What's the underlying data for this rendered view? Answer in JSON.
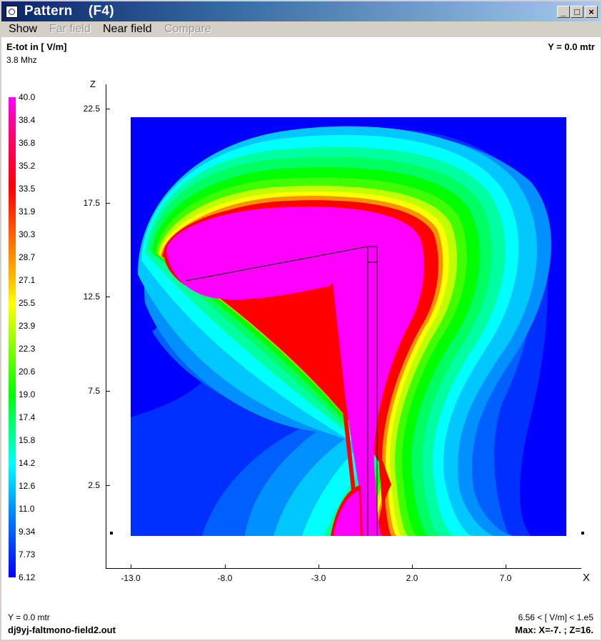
{
  "window": {
    "title": "Pattern    (F4)",
    "buttons": {
      "minimize": "_",
      "maximize": "□",
      "close": "×"
    }
  },
  "menu": [
    {
      "label": "Show",
      "enabled": true
    },
    {
      "label": "Far field",
      "enabled": false
    },
    {
      "label": "Near field",
      "enabled": true
    },
    {
      "label": "Compare",
      "enabled": false
    }
  ],
  "header": {
    "quantity": "E-tot in [ V/m]",
    "frequency": "3.8 Mhz",
    "plane": "Y = 0.0 mtr"
  },
  "footer": {
    "plane": "Y = 0.0 mtr",
    "filename": "dj9yj-faltmono-field2.out",
    "range": "6.56 < [ V/m] < 1.e5",
    "max": "Max: X=-7. ; Z=16."
  },
  "legend": {
    "values": [
      "40.0",
      "38.4",
      "36.8",
      "35.2",
      "33.5",
      "31.9",
      "30.3",
      "28.7",
      "27.1",
      "25.5",
      "23.9",
      "22.3",
      "20.6",
      "19.0",
      "17.4",
      "15.8",
      "14.2",
      "12.6",
      "11.0",
      "9.34",
      "7.73",
      "6.12"
    ],
    "colors": [
      "#ff00ff",
      "#ff00a0",
      "#ff0060",
      "#ff0030",
      "#ff0000",
      "#ff3000",
      "#ff6000",
      "#ff9000",
      "#ffc000",
      "#ffff00",
      "#c0ff00",
      "#80ff00",
      "#40ff00",
      "#00ff00",
      "#00ff60",
      "#00ffa0",
      "#00ffff",
      "#00c8ff",
      "#0090ff",
      "#0060ff",
      "#0030ff",
      "#0000ff"
    ]
  },
  "chart_data": {
    "type": "heatmap",
    "xlabel": "X",
    "ylabel": "Z",
    "x_ticks": [
      "-13.0",
      "-8.0",
      "-3.0",
      "2.0",
      "7.0"
    ],
    "y_ticks": [
      "22.5",
      "17.5",
      "12.5",
      "7.5",
      "2.5"
    ],
    "colorbar_label": "E-tot in [ V/m]",
    "colorbar_range": [
      6.12,
      40.0
    ]
  }
}
